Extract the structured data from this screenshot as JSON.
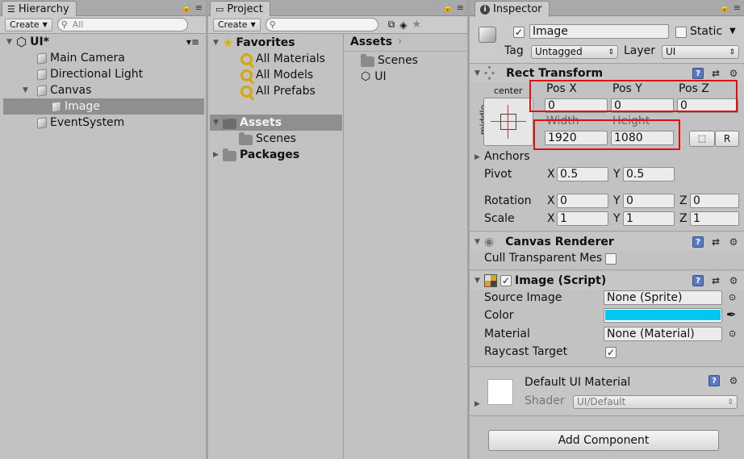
{
  "hierarchy": {
    "tab": "Hierarchy",
    "create": "Create",
    "search_placeholder": "All",
    "scene": "UI*",
    "items": [
      "Main Camera",
      "Directional Light",
      "Canvas",
      "Image",
      "EventSystem"
    ]
  },
  "project": {
    "tab": "Project",
    "create": "Create",
    "favorites": {
      "label": "Favorites",
      "items": [
        "All Materials",
        "All Models",
        "All Prefabs"
      ]
    },
    "assets_label": "Assets",
    "scenes_label": "Scenes",
    "packages_label": "Packages",
    "breadcrumb": "Assets",
    "content": [
      "Scenes",
      "UI"
    ]
  },
  "inspector": {
    "tab": "Inspector",
    "object_name": "Image",
    "static_label": "Static",
    "tag_label": "Tag",
    "tag_value": "Untagged",
    "layer_label": "Layer",
    "layer_value": "UI",
    "rect_transform": {
      "title": "Rect Transform",
      "anchor_h": "center",
      "anchor_v": "middle",
      "pos_x_label": "Pos X",
      "pos_y_label": "Pos Y",
      "pos_z_label": "Pos Z",
      "pos_x": "0",
      "pos_y": "0",
      "pos_z": "0",
      "width_label": "Width",
      "height_label": "Height",
      "width": "1920",
      "height": "1080",
      "r_button": "R",
      "anchors": "Anchors",
      "pivot_label": "Pivot",
      "pivot_x": "0.5",
      "pivot_y": "0.5",
      "rotation_label": "Rotation",
      "rot_x": "0",
      "rot_y": "0",
      "rot_z": "0",
      "scale_label": "Scale",
      "scale_x": "1",
      "scale_y": "1",
      "scale_z": "1",
      "x": "X",
      "y": "Y",
      "z": "Z"
    },
    "canvas_renderer": {
      "title": "Canvas Renderer",
      "cull_label": "Cull Transparent Mes"
    },
    "image_script": {
      "title": "Image (Script)",
      "source_label": "Source Image",
      "source_value": "None (Sprite)",
      "color_label": "Color",
      "color_value": "#00c8f0",
      "material_label": "Material",
      "material_value": "None (Material)",
      "raycast_label": "Raycast Target"
    },
    "material": {
      "title": "Default UI Material",
      "shader_label": "Shader",
      "shader_value": "UI/Default"
    },
    "add_component": "Add Component"
  }
}
